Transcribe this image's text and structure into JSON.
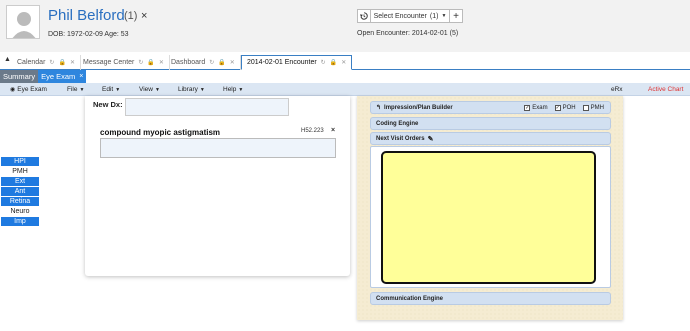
{
  "header": {
    "patient_name": "Phil Belford",
    "patient_count": "(1)",
    "close_glyph": "×",
    "dob_line": "DOB: 1972-02-09 Age: 53",
    "encounter_select_label": "Select Encounter",
    "encounter_select_count": "(1)",
    "open_encounter": "Open Encounter: 2014-02-01 (5)"
  },
  "tabs": {
    "items": [
      {
        "label": "Calendar"
      },
      {
        "label": "Message Center"
      },
      {
        "label": "Dashboard"
      },
      {
        "label": "2014-02-01 Encounter"
      }
    ]
  },
  "subtabs": {
    "summary": "Summary",
    "eye_exam": "Eye Exam",
    "close_glyph": "×"
  },
  "menu": {
    "eye_exam": "Eye Exam",
    "file": "File",
    "edit": "Edit",
    "view": "View",
    "library": "Library",
    "help": "Help",
    "erx": "eRx",
    "active_chart": "Active Chart"
  },
  "leftnav": {
    "items": [
      "HPI",
      "PMH",
      "Ext",
      "Ant",
      "Retina",
      "Neuro",
      "Imp"
    ]
  },
  "diagnosis": {
    "new_dx_label": "New Dx:",
    "title": "compound myopic astigmatism",
    "code": "H52.223",
    "close_glyph": "×"
  },
  "plan": {
    "impression_builder": "Impression/Plan Builder",
    "exam_label": "Exam",
    "poh_label": "POH",
    "pmh_label": "PMH",
    "coding_engine": "Coding Engine",
    "next_visit_orders": "Next Visit Orders",
    "communication_engine": "Communication Engine"
  },
  "colors": {
    "accent": "#2a6fc0",
    "tab_active": "#2e86de",
    "nav_button": "#1f7ae0",
    "menubar": "#dbe6f3",
    "active_chart": "#dd3333",
    "orders_yellow": "#ffff99",
    "plan_bg": "#f5ecd2"
  }
}
